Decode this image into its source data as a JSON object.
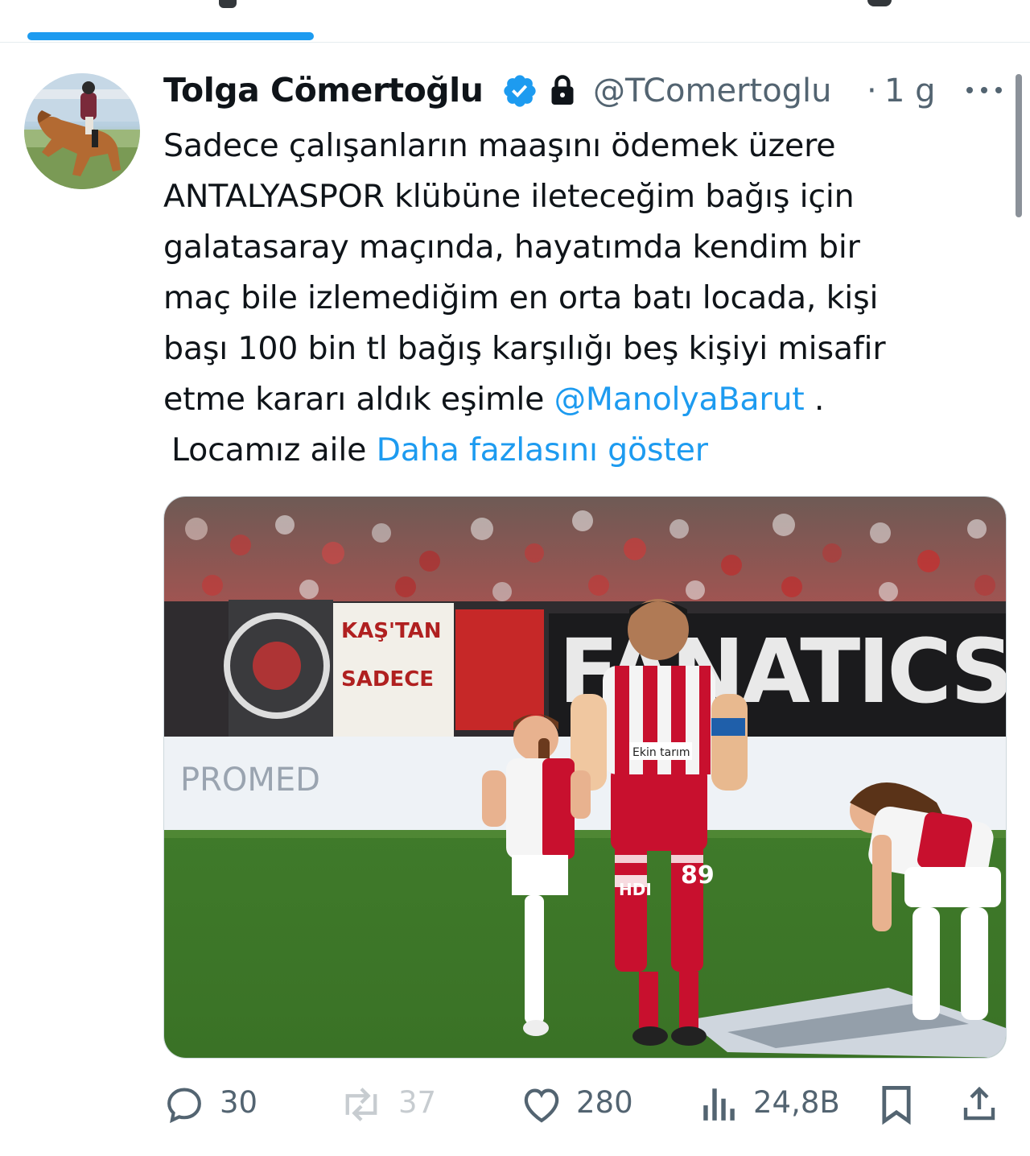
{
  "tweet": {
    "author": {
      "display_name": "Tolga Cömertoğlu",
      "handle": "@TComertoglu"
    },
    "separator": "·",
    "timestamp": "1 g",
    "text": {
      "line1": "Sadece çalışanların maaşını ödemek üzere",
      "line2": "ANTALYASPOR klübüne ileteceğim bağış için",
      "line3": "galatasaray maçında, hayatımda kendim bir",
      "line4": "maç bile izlemediğim en orta batı locada, kişi",
      "line5": "başı 100 bin tl bağış karşılığı beş kişiyi misafir",
      "line6_before": "etme kararı aldık eşimle ",
      "mention": "@ManolyaBarut",
      "line6_after": " .",
      "line7": "Locamız aile ",
      "show_more": "Daha fazlasını göster"
    },
    "media": {
      "banner_left_1": "KAŞ'TAN",
      "banner_left_2": "SADECE",
      "banner_right": "FANATICS",
      "board_text": "PROMED",
      "jersey_sponsor": "Ekin tarım",
      "shorts_sponsor": "HDI",
      "player_number": "89"
    },
    "actions": {
      "replies": "30",
      "reposts": "37",
      "likes": "280",
      "views": "24,8B"
    }
  },
  "colors": {
    "accent": "#1d9bf0",
    "secondary_text": "#536471",
    "primary_text": "#0f1419"
  },
  "icons": [
    "verified-badge-icon",
    "lock-icon",
    "more-icon",
    "reply-icon",
    "repost-icon",
    "like-icon",
    "views-icon",
    "bookmark-icon",
    "share-icon"
  ]
}
